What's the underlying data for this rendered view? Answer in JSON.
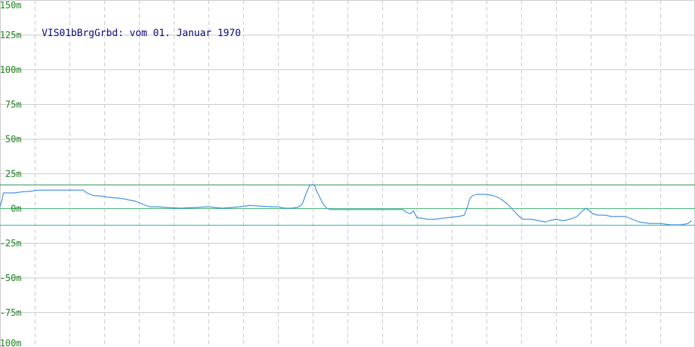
{
  "chart_data": {
    "type": "line",
    "title": "VIS01bBrgGrbd: vom 01. Januar 1970",
    "xlabel": "",
    "ylabel": "",
    "ylim": [
      -100,
      150
    ],
    "x_range": [
      0,
      1000
    ],
    "y_tick_labels": [
      "150m",
      "125m",
      "100m",
      "75m",
      "50m",
      "25m",
      "0m",
      "-25m",
      "-50m",
      "-75m",
      "-100m"
    ],
    "y_tick_values": [
      150,
      125,
      100,
      75,
      50,
      25,
      0,
      -25,
      -50,
      -75,
      -100
    ],
    "x_grid_values": [
      50,
      100,
      150,
      200,
      250,
      300,
      350,
      400,
      450,
      500,
      550,
      600,
      650,
      700,
      750,
      800,
      850,
      900,
      950
    ],
    "grid": true,
    "reference_lines": [
      {
        "value": 17,
        "color": "#2e8b57"
      },
      {
        "value": 0,
        "color": "#3cb371"
      },
      {
        "value": -12,
        "color": "#20b2aa"
      }
    ],
    "series": [
      {
        "color": "#3a8ee0",
        "x": [
          0,
          3,
          5,
          10,
          20,
          35,
          40,
          55,
          70,
          100,
          110,
          120,
          125,
          135,
          140,
          155,
          175,
          195,
          205,
          215,
          225,
          260,
          300,
          320,
          345,
          360,
          390,
          400,
          410,
          420,
          430,
          435,
          440,
          445,
          448,
          450,
          453,
          456,
          460,
          465,
          470,
          475,
          480,
          500,
          540,
          580,
          585,
          590,
          595,
          600,
          605,
          615,
          625,
          640,
          660,
          668,
          672,
          676,
          680,
          685,
          690,
          700,
          710,
          720,
          730,
          738,
          745,
          752,
          758,
          765,
          775,
          785,
          790,
          800,
          810,
          820,
          830,
          838,
          843,
          848,
          853,
          860,
          870,
          880,
          900,
          910,
          920,
          935,
          950,
          965,
          980,
          990,
          995
        ],
        "y": [
          1,
          6,
          11,
          11,
          11,
          12,
          12,
          13,
          13,
          13,
          13,
          13,
          11,
          9,
          9,
          8,
          7,
          5,
          3,
          1,
          1,
          0,
          1,
          0,
          1,
          2,
          1,
          1,
          0,
          0,
          1,
          3,
          10,
          16,
          17,
          17,
          16,
          12,
          8,
          3,
          0,
          -1,
          -1,
          -1,
          -1,
          -1,
          -3,
          -4,
          -2,
          -7,
          -7,
          -8,
          -8,
          -7,
          -6,
          -5,
          0,
          7,
          9,
          10,
          10,
          10,
          9,
          7,
          3,
          -1,
          -5,
          -8,
          -8,
          -8,
          -9,
          -10,
          -9,
          -8,
          -9,
          -8,
          -6,
          -2,
          0,
          -2,
          -4,
          -5,
          -5,
          -6,
          -6,
          -8,
          -10,
          -11,
          -11,
          -12,
          -12,
          -11,
          -9
        ]
      }
    ]
  },
  "style": {
    "background": "#ffffff",
    "grid_color": "#c8c8c8",
    "title_color": "#0a0a80",
    "tick_color": "#208020"
  }
}
